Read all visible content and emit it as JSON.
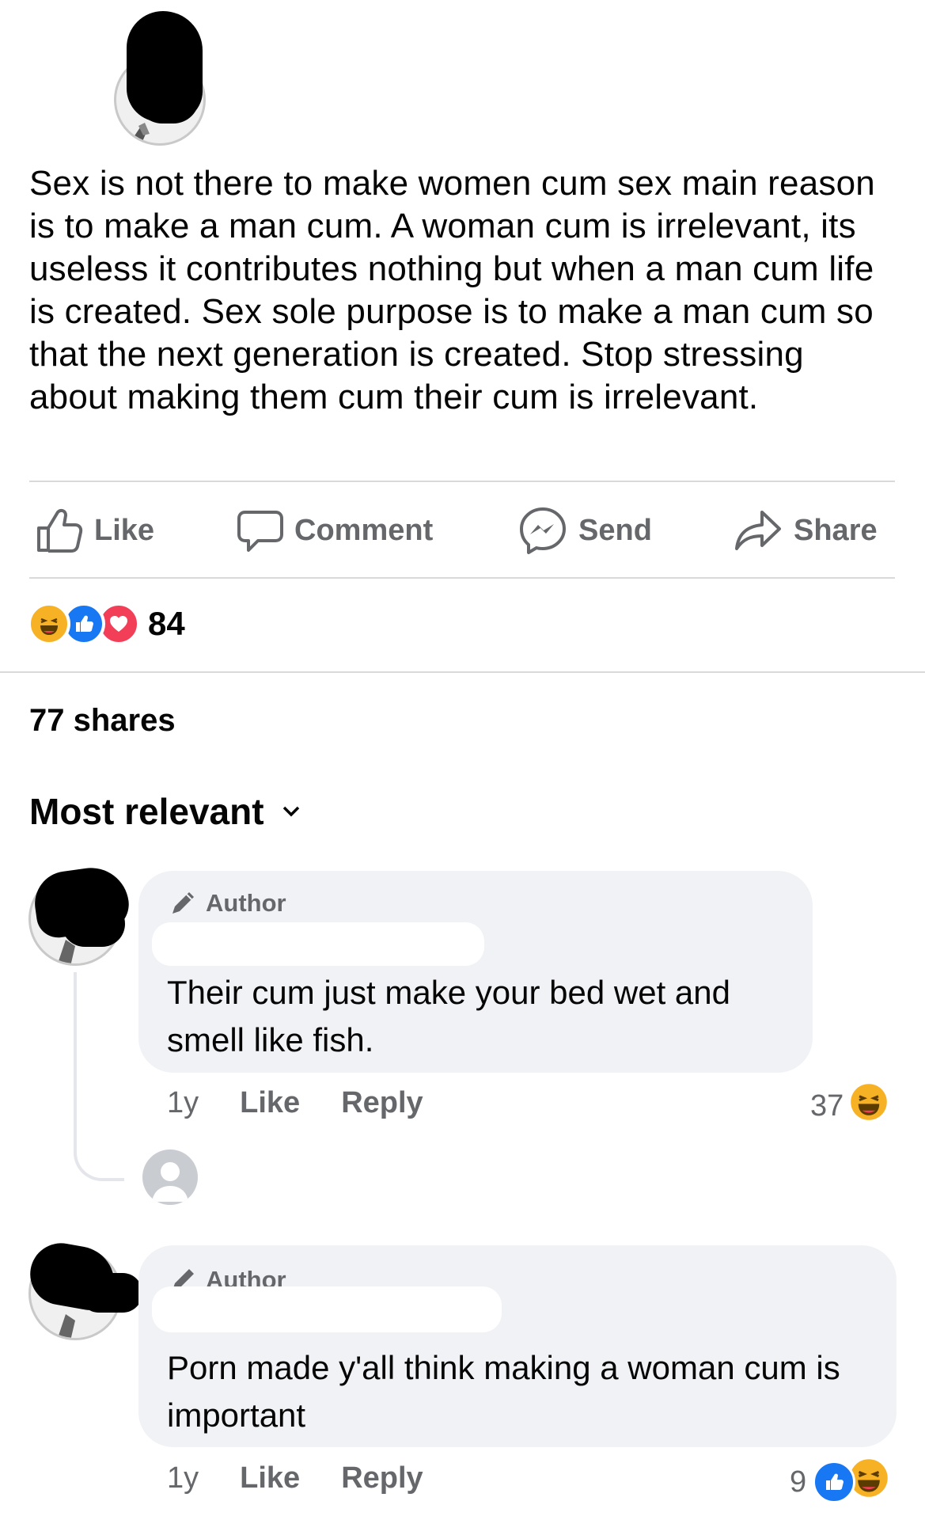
{
  "post": {
    "text": "Sex is not there to make women cum sex main reason is to make a man cum. A woman cum is irrelevant, its useless it contributes nothing but when a man cum life is created. Sex sole purpose is to make a man cum so that the next generation is created. Stop stressing about making them cum their cum is irrelevant."
  },
  "actions": {
    "like": "Like",
    "comment": "Comment",
    "send": "Send",
    "share": "Share"
  },
  "reactions": {
    "count": "84",
    "types": [
      "haha-icon",
      "like-icon",
      "love-icon"
    ]
  },
  "shares": "77 shares",
  "sort": {
    "label": "Most relevant"
  },
  "comments": [
    {
      "badge": "Author",
      "text": "Their cum just make your bed wet and smell like fish.",
      "time": "1y",
      "like": "Like",
      "reply": "Reply",
      "reaction_count": "37",
      "reaction_types": [
        "haha-icon"
      ]
    },
    {
      "badge": "Author",
      "text": "Porn made y'all think making a woman cum is important",
      "time": "1y",
      "like": "Like",
      "reply": "Reply",
      "reaction_count": "9",
      "reaction_types": [
        "like-icon",
        "haha-icon"
      ]
    }
  ],
  "colors": {
    "like_blue": "#1877f2",
    "love_red": "#f33e58",
    "haha_yellow": "#f7b125",
    "secondary_text": "#65676b",
    "bubble_bg": "#f0f2f5"
  }
}
